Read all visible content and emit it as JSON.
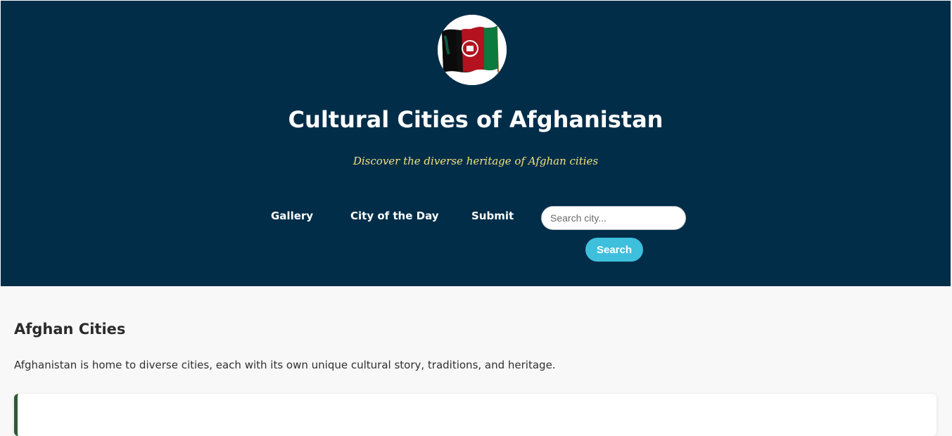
{
  "header": {
    "logo_alt": "Afghan flag",
    "title": "Cultural Cities of Afghanistan",
    "tagline": "Discover the diverse heritage of Afghan cities",
    "colors": {
      "background": "#012d49",
      "tagline": "#f4e27c",
      "button": "#3ebfdc"
    }
  },
  "nav": {
    "items": [
      {
        "label": "Gallery"
      },
      {
        "label": "City of the Day"
      },
      {
        "label": "Submit"
      }
    ]
  },
  "search": {
    "placeholder": "Search city...",
    "value": "",
    "button_label": "Search"
  },
  "main": {
    "heading": "Afghan Cities",
    "intro": "Afghanistan is home to diverse cities, each with its own unique cultural story, traditions, and heritage.",
    "card_accent": "#2e5a34"
  }
}
